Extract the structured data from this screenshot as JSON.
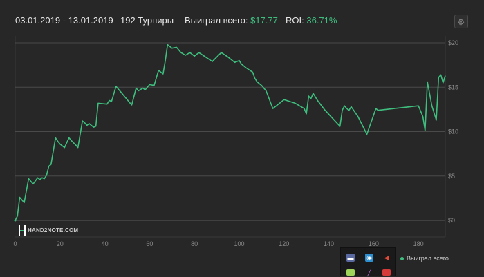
{
  "header": {
    "date_range": "03.01.2019 - 13.01.2019",
    "tournaments": "192 Турниры",
    "won_label": "Выиграл всего:",
    "won_value": "$17.77",
    "roi_label": "ROI:",
    "roi_value": "36.71%"
  },
  "watermark": {
    "text": "HAND2NOTE.COM"
  },
  "legend": {
    "label": "Выиграл всего"
  },
  "colors": {
    "background": "#272727",
    "line": "#3fbf7f",
    "accent": "#3fbf7f",
    "grid": "#4a4a4a"
  },
  "icons": {
    "settings": "gear-icon",
    "tray": [
      "monitor-icon",
      "network-icon",
      "speaker-icon",
      "notes-icon",
      "pen-icon",
      "app-icon"
    ]
  },
  "chart_data": {
    "type": "line",
    "x": [
      0,
      1,
      2,
      4,
      6,
      7,
      8,
      10,
      11,
      12,
      13,
      14,
      15,
      16,
      18,
      19,
      20,
      22,
      24,
      25,
      27,
      28,
      30,
      31,
      32,
      33,
      35,
      36,
      37,
      41,
      42,
      43,
      45,
      46,
      47,
      48,
      49,
      50,
      51,
      52,
      54,
      55,
      57,
      58,
      60,
      62,
      64,
      66,
      67,
      68,
      70,
      72,
      73,
      74,
      76,
      78,
      80,
      82,
      85,
      88,
      92,
      95,
      98,
      100,
      101,
      103,
      106,
      107,
      108,
      110,
      112,
      115,
      120,
      125,
      129,
      130,
      131,
      132,
      133,
      135,
      138,
      145,
      146,
      147,
      148,
      149,
      150,
      153,
      157,
      161,
      162,
      180,
      182,
      183,
      184,
      186,
      188,
      189,
      190,
      191,
      192
    ],
    "series": [
      {
        "name": "Выиграл всего",
        "values": [
          0,
          0.5,
          2.6,
          2.0,
          4.7,
          4.4,
          4.1,
          4.8,
          4.6,
          4.8,
          4.7,
          5.1,
          6.1,
          6.3,
          9.3,
          8.9,
          8.6,
          8.2,
          9.3,
          9.0,
          8.5,
          8.2,
          11.2,
          11.0,
          10.7,
          10.9,
          10.5,
          10.6,
          13.2,
          13.1,
          13.5,
          13.4,
          15.1,
          14.8,
          14.5,
          14.2,
          13.9,
          13.6,
          13.3,
          13.0,
          14.9,
          14.6,
          14.9,
          14.7,
          15.3,
          15.2,
          16.9,
          16.5,
          18.0,
          19.8,
          19.4,
          19.5,
          19.2,
          18.9,
          18.6,
          18.9,
          18.5,
          18.9,
          18.4,
          17.9,
          18.9,
          18.4,
          17.8,
          18.0,
          17.6,
          17.2,
          16.7,
          16.0,
          15.6,
          15.2,
          14.6,
          12.6,
          13.6,
          13.2,
          12.6,
          12.0,
          14.0,
          13.7,
          14.3,
          13.5,
          12.5,
          10.6,
          12.4,
          12.9,
          12.6,
          12.4,
          12.8,
          11.7,
          9.7,
          12.6,
          12.4,
          12.9,
          11.7,
          10.1,
          15.6,
          12.9,
          11.3,
          16.1,
          16.4,
          15.5,
          16.3
        ]
      }
    ],
    "x_ticks": [
      0,
      20,
      40,
      60,
      80,
      100,
      120,
      140,
      160,
      180
    ],
    "y_ticks": [
      0,
      5,
      10,
      15,
      20
    ],
    "y_tick_labels": [
      "$0",
      "$5",
      "$10",
      "$15",
      "$20"
    ],
    "xlim": [
      0,
      192
    ],
    "ylim": [
      0,
      20
    ],
    "grid": "horizontal",
    "legend_position": "bottom-right"
  }
}
